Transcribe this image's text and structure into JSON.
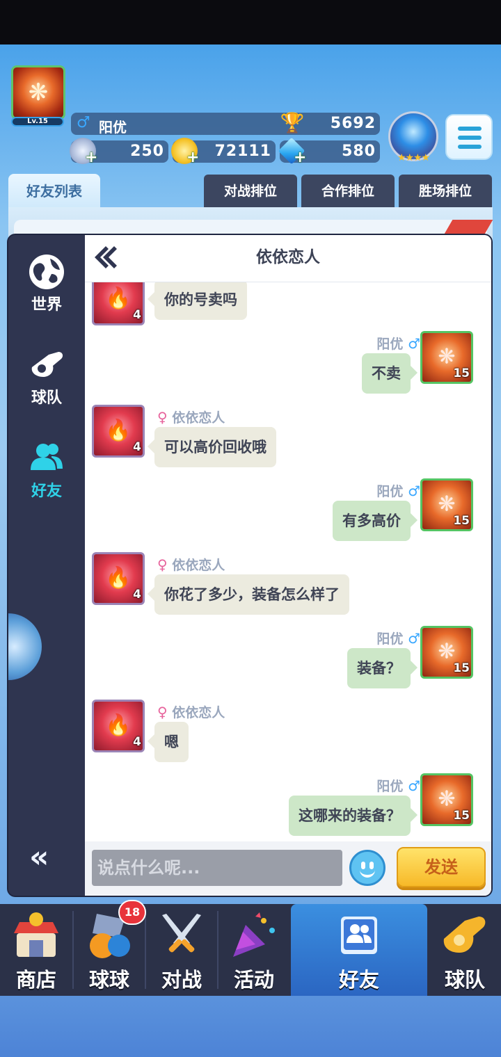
{
  "player": {
    "name": "阳优",
    "level": "Lv.15",
    "trophies": "5692",
    "stamina": "250",
    "coins": "72111",
    "diamonds": "580"
  },
  "tabs": {
    "friends_list": "好友列表",
    "battle_rank": "对战排位",
    "coop_rank": "合作排位",
    "wins_rank": "胜场排位"
  },
  "side_nav": {
    "world": "世界",
    "team": "球队",
    "friends": "好友"
  },
  "chat": {
    "title": "依依恋人",
    "friend_name": "依依恋人",
    "friend_level": "4",
    "my_name": "阳优",
    "my_level": "15",
    "messages": [
      {
        "from": "theirs",
        "text": "你的号卖吗"
      },
      {
        "from": "mine",
        "text": "不卖"
      },
      {
        "from": "theirs",
        "text": "可以高价回收哦"
      },
      {
        "from": "mine",
        "text": "有多高价"
      },
      {
        "from": "theirs",
        "text": "你花了多少，装备怎么样了"
      },
      {
        "from": "mine",
        "text": "装备？"
      },
      {
        "from": "theirs",
        "text": "嗯"
      },
      {
        "from": "mine",
        "text": "这哪来的装备？"
      }
    ],
    "input_placeholder": "说点什么呢...",
    "send_label": "发送"
  },
  "bottom_nav": {
    "shop": "商店",
    "balls": "球球",
    "balls_badge": "18",
    "battle": "对战",
    "events": "活动",
    "friends": "好友",
    "team": "球队"
  },
  "colors": {
    "active_nav": "#2fd2e8",
    "bubble_theirs": "#ecebdf",
    "bubble_mine": "#cde7c8",
    "send_button": "#f7b928"
  }
}
